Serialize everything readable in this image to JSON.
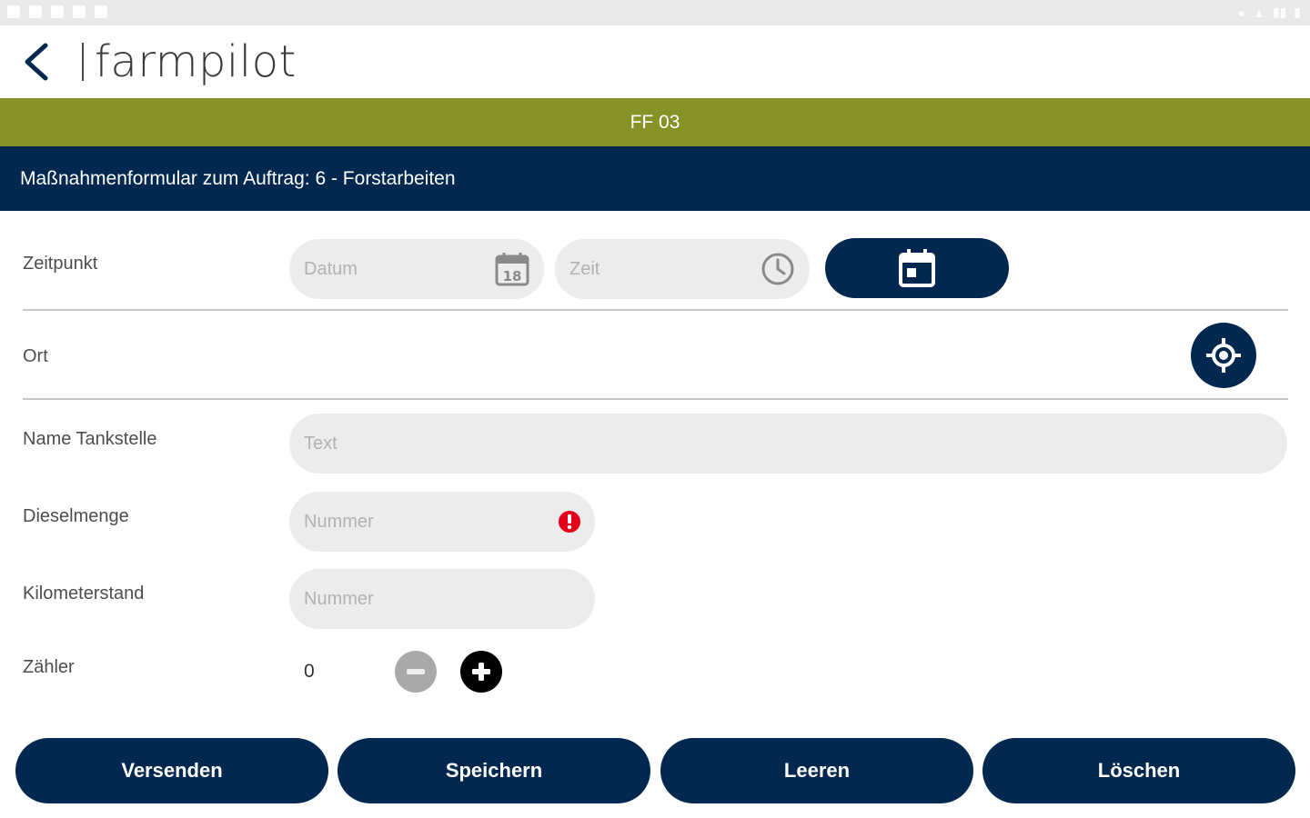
{
  "app": {
    "name": "farmpilot"
  },
  "banner": {
    "code": "FF 03"
  },
  "form": {
    "heading": "Maßnahmenformular zum Auftrag: 6 - Forstarbeiten",
    "zeitpunkt": {
      "label": "Zeitpunkt",
      "date_placeholder": "Datum",
      "time_placeholder": "Zeit",
      "calendar_day": "18"
    },
    "ort": {
      "label": "Ort"
    },
    "tankstelle": {
      "label": "Name Tankstelle",
      "placeholder": "Text"
    },
    "diesel": {
      "label": "Dieselmenge",
      "placeholder": "Nummer"
    },
    "km": {
      "label": "Kilometerstand",
      "placeholder": "Nummer"
    },
    "counter": {
      "label": "Zähler",
      "value": "0"
    }
  },
  "actions": {
    "send": "Versenden",
    "save": "Speichern",
    "clear": "Leeren",
    "delete": "Löschen"
  },
  "colors": {
    "navy": "#022850",
    "green": "#879326",
    "error": "#e3001b",
    "field": "#ececec"
  },
  "icons": [
    "back-arrow-icon",
    "calendar-icon",
    "clock-icon",
    "calendar-today-icon",
    "location-target-icon",
    "error-icon",
    "minus-icon",
    "plus-icon"
  ]
}
